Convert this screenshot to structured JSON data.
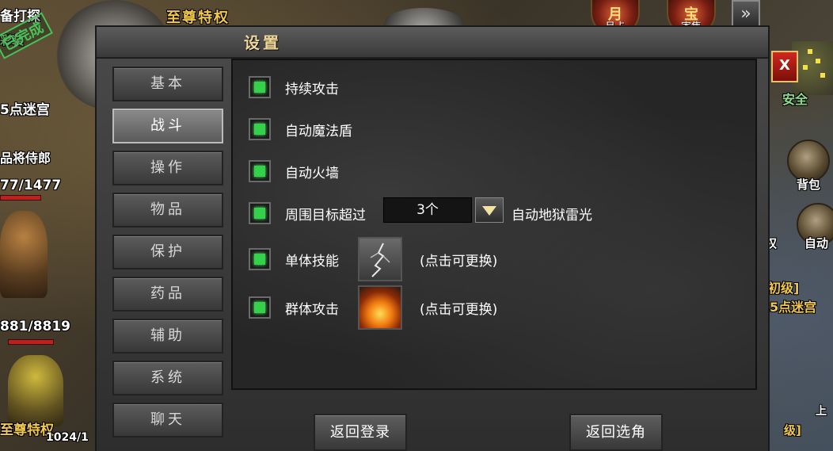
{
  "background": {
    "top_left_quest": "备打探",
    "stamp": "已完成",
    "stamp_prefix": "彩装",
    "location_left": "5点迷宫",
    "npc_name": "品将侍郎",
    "hp_1": "77/1477",
    "hp_2": "881/8819",
    "bottom_left": "至尊特权",
    "bottom_left_num": "1024/1",
    "top_banner": "至尊特权",
    "top_icons": [
      {
        "label": "月卡",
        "glyph": "月"
      },
      {
        "label": "寄售",
        "glyph": "宝"
      }
    ],
    "expand_glyph": "»",
    "safe_zone": "安全",
    "bag_label": "背包",
    "auto_label": "自动",
    "side_letter": "权",
    "right_level": "初级]",
    "right_location": "5点迷宫",
    "right_bottom": "级]",
    "right_bottom_b": "上"
  },
  "dialog": {
    "title": "设置",
    "close_label": "X",
    "tabs": [
      "基本",
      "战斗",
      "操作",
      "物品",
      "保护",
      "药品",
      "辅助",
      "系统",
      "聊天"
    ],
    "active_tab": "战斗",
    "options": {
      "continuous_attack": {
        "label": "持续攻击",
        "checked": true
      },
      "auto_magic_shield": {
        "label": "自动魔法盾",
        "checked": true
      },
      "auto_firewall": {
        "label": "自动火墙",
        "checked": true
      },
      "nearby_targets": {
        "label": "周围目标超过",
        "checked": true,
        "value": "3个",
        "suffix": "自动地狱雷光"
      },
      "single_skill": {
        "label": "单体技能",
        "checked": true,
        "hint": "(点击可更换)"
      },
      "group_attack": {
        "label": "群体攻击",
        "checked": true,
        "hint": "(点击可更换)"
      }
    },
    "footer": {
      "back_to_login": "返回登录",
      "back_to_role_select": "返回选角"
    }
  },
  "colors": {
    "checkbox_on": "#34d24a",
    "title_gold": "#f0d89a",
    "close_red": "#d0281e"
  }
}
